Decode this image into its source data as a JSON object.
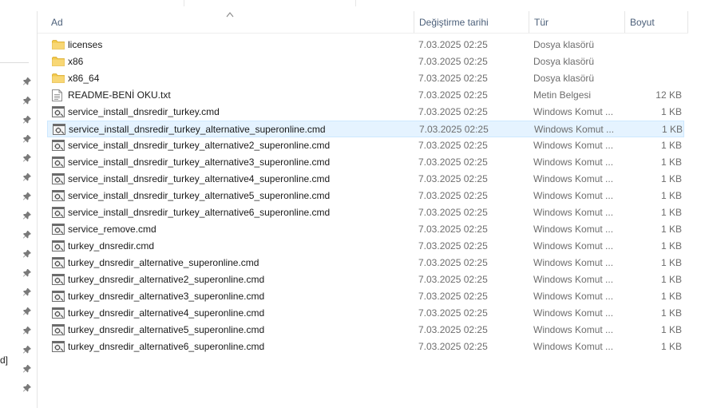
{
  "header": {
    "name_label": "Ad",
    "date_label": "Değiştirme tarihi",
    "type_label": "Tür",
    "size_label": "Boyut"
  },
  "nav": {
    "truncated_text": "d]"
  },
  "colors": {
    "folder": "#f2c94c",
    "selected_bg": "#e5f3ff",
    "selected_border": "#cde8ff",
    "header_text": "#4c607a"
  },
  "files": [
    {
      "name": "licenses",
      "date": "7.03.2025 02:25",
      "type": "Dosya klasörü",
      "size": "",
      "icon": "folder-icon"
    },
    {
      "name": "x86",
      "date": "7.03.2025 02:25",
      "type": "Dosya klasörü",
      "size": "",
      "icon": "folder-icon"
    },
    {
      "name": "x86_64",
      "date": "7.03.2025 02:25",
      "type": "Dosya klasörü",
      "size": "",
      "icon": "folder-icon"
    },
    {
      "name": "README-BENİ OKU.txt",
      "date": "7.03.2025 02:25",
      "type": "Metin Belgesi",
      "size": "12 KB",
      "icon": "text-file-icon"
    },
    {
      "name": "service_install_dnsredir_turkey.cmd",
      "date": "7.03.2025 02:25",
      "type": "Windows Komut ...",
      "size": "1 KB",
      "icon": "cmd-file-icon"
    },
    {
      "name": "service_install_dnsredir_turkey_alternative_superonline.cmd",
      "date": "7.03.2025 02:25",
      "type": "Windows Komut ...",
      "size": "1 KB",
      "icon": "cmd-file-icon",
      "selected": true
    },
    {
      "name": "service_install_dnsredir_turkey_alternative2_superonline.cmd",
      "date": "7.03.2025 02:25",
      "type": "Windows Komut ...",
      "size": "1 KB",
      "icon": "cmd-file-icon"
    },
    {
      "name": "service_install_dnsredir_turkey_alternative3_superonline.cmd",
      "date": "7.03.2025 02:25",
      "type": "Windows Komut ...",
      "size": "1 KB",
      "icon": "cmd-file-icon"
    },
    {
      "name": "service_install_dnsredir_turkey_alternative4_superonline.cmd",
      "date": "7.03.2025 02:25",
      "type": "Windows Komut ...",
      "size": "1 KB",
      "icon": "cmd-file-icon"
    },
    {
      "name": "service_install_dnsredir_turkey_alternative5_superonline.cmd",
      "date": "7.03.2025 02:25",
      "type": "Windows Komut ...",
      "size": "1 KB",
      "icon": "cmd-file-icon"
    },
    {
      "name": "service_install_dnsredir_turkey_alternative6_superonline.cmd",
      "date": "7.03.2025 02:25",
      "type": "Windows Komut ...",
      "size": "1 KB",
      "icon": "cmd-file-icon"
    },
    {
      "name": "service_remove.cmd",
      "date": "7.03.2025 02:25",
      "type": "Windows Komut ...",
      "size": "1 KB",
      "icon": "cmd-file-icon"
    },
    {
      "name": "turkey_dnsredir.cmd",
      "date": "7.03.2025 02:25",
      "type": "Windows Komut ...",
      "size": "1 KB",
      "icon": "cmd-file-icon"
    },
    {
      "name": "turkey_dnsredir_alternative_superonline.cmd",
      "date": "7.03.2025 02:25",
      "type": "Windows Komut ...",
      "size": "1 KB",
      "icon": "cmd-file-icon"
    },
    {
      "name": "turkey_dnsredir_alternative2_superonline.cmd",
      "date": "7.03.2025 02:25",
      "type": "Windows Komut ...",
      "size": "1 KB",
      "icon": "cmd-file-icon"
    },
    {
      "name": "turkey_dnsredir_alternative3_superonline.cmd",
      "date": "7.03.2025 02:25",
      "type": "Windows Komut ...",
      "size": "1 KB",
      "icon": "cmd-file-icon"
    },
    {
      "name": "turkey_dnsredir_alternative4_superonline.cmd",
      "date": "7.03.2025 02:25",
      "type": "Windows Komut ...",
      "size": "1 KB",
      "icon": "cmd-file-icon"
    },
    {
      "name": "turkey_dnsredir_alternative5_superonline.cmd",
      "date": "7.03.2025 02:25",
      "type": "Windows Komut ...",
      "size": "1 KB",
      "icon": "cmd-file-icon"
    },
    {
      "name": "turkey_dnsredir_alternative6_superonline.cmd",
      "date": "7.03.2025 02:25",
      "type": "Windows Komut ...",
      "size": "1 KB",
      "icon": "cmd-file-icon"
    }
  ]
}
